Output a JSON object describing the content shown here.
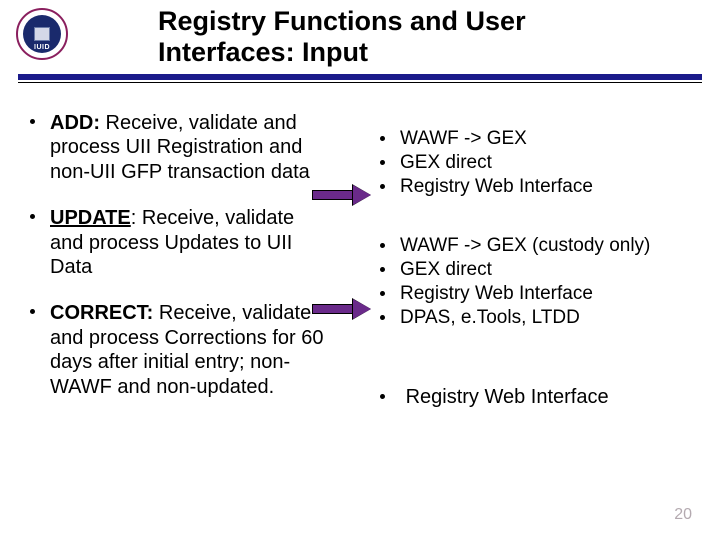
{
  "logo_label": "IUID",
  "title_line1": "Registry Functions and User",
  "title_line2": "Interfaces: Input",
  "left": {
    "add_lead": "ADD:",
    "add_body": " Receive, validate and process UII Registration and non-UII GFP transaction data",
    "update_lead": "UPDATE",
    "update_body": ": Receive, validate and process Updates to UII Data",
    "correct_lead": "CORRECT:",
    "correct_body": " Receive, validate and process Corrections for 60 days after initial entry; non-WAWF and non-updated."
  },
  "right": {
    "block1": [
      "WAWF -> GEX",
      "GEX direct",
      "Registry Web Interface"
    ],
    "block2": [
      "WAWF -> GEX (custody only)",
      "GEX direct",
      "Registry Web Interface",
      "DPAS, e.Tools, LTDD"
    ],
    "block3": [
      "Registry Web Interface"
    ]
  },
  "page_number": "20"
}
